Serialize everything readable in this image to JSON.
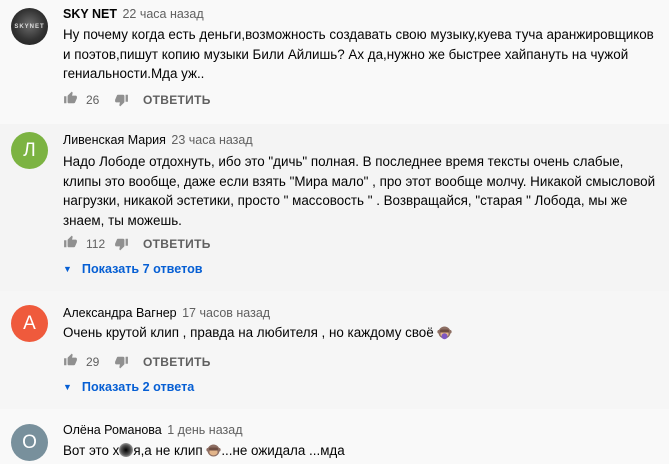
{
  "comments": [
    {
      "author": "SKY NET",
      "time": "22 часа назад",
      "avatar_text": "SKYNET",
      "text": "Ну почему когда есть деньги,возможность создавать свою музыку,куева туча аранжировщиков и поэтов,пишут копию музыки Били Айлишь?  Ах да,нужно же быстрее хайпануть на чужой гениальности.Мда уж..",
      "likes": "26",
      "reply_label": "ОТВЕТИТЬ"
    },
    {
      "author": "Ливенская Мария",
      "time": "23 часа назад",
      "avatar_letter": "Л",
      "avatar_color": "#7cb342",
      "text": "Надо Лободе отдохнуть, ибо это \"дичь\" полная. В последнее время тексты очень слабые, клипы это вообще, даже если взять \"Мира мало\" , про этот вообще молчу. Никакой смысловой нагрузки, никакой эстетики, просто \" массовость \" .  Возвращайся, \"старая \" Лобода, мы же знаем, ты можешь.",
      "likes": "112",
      "reply_label": "ОТВЕТИТЬ",
      "show_replies": "Показать 7 ответов"
    },
    {
      "author": "Александра Вагнер",
      "time": "17 часов назад",
      "avatar_letter": "А",
      "avatar_color": "#ef5a3c",
      "text": "Очень крутой клип , правда на любителя , но каждому своё",
      "likes": "29",
      "reply_label": "ОТВЕТИТЬ",
      "show_replies": "Показать 2 ответа"
    },
    {
      "author": "Олёна Романова",
      "time": "1 день назад",
      "avatar_letter": "О",
      "avatar_color": "#78909c",
      "text_part1": "Вот это х",
      "text_part2": "я,а не клип",
      "text_part3": "...не ожидала ...мда"
    }
  ],
  "colors": {
    "link_blue": "#065fd4",
    "meta_gray": "#606060"
  },
  "icons": [
    "thumbs-up-icon",
    "thumbs-down-icon",
    "caret-down-icon",
    "monkey-emoji-icon"
  ]
}
